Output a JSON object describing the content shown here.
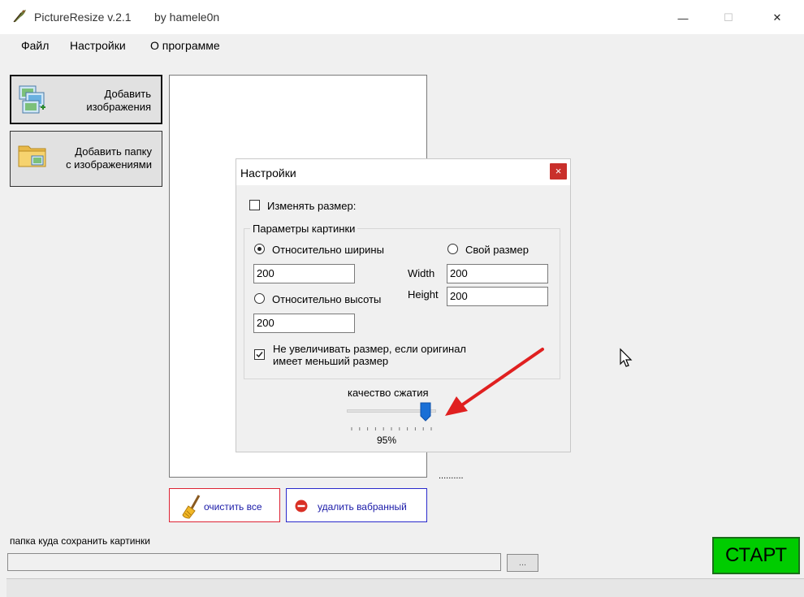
{
  "window": {
    "title": "PictureResize v.2.1",
    "author": "by hamele0n",
    "controls": {
      "minimize": "—",
      "maximize": "☐",
      "close": "✕"
    }
  },
  "menu": {
    "file": "Файл",
    "settings": "Настройки",
    "about": "О программе"
  },
  "buttons": {
    "add_images_line1": "Добавить",
    "add_images_line2": "изображения",
    "add_folder_line1": "Добавить папку",
    "add_folder_line2": "с изображениями",
    "clear_all": "очистить все",
    "delete_selected": "удалить вабранный",
    "browse": "...",
    "start": "СТАРТ"
  },
  "dots": {
    "row1": "..........",
    "row2": ".........."
  },
  "save_folder": {
    "label": "папка куда сохранить картинки",
    "value": ""
  },
  "settings_dialog": {
    "title": "Настройки",
    "close": "×",
    "resize_label": "Изменять размер:",
    "resize_checked": false,
    "params_group": "Параметры картинки",
    "relative_width_label": "Относительно ширины",
    "relative_width_selected": true,
    "custom_size_label": "Свой размер",
    "custom_size_selected": false,
    "width_value": "200",
    "custom_width_label": "Width",
    "custom_width_value": "200",
    "custom_height_label": "Height",
    "custom_height_value": "200",
    "relative_height_label": "Относительно высоты",
    "relative_height_selected": false,
    "height_value": "200",
    "no_enlarge_line1": "Не увеличивать размер, если оригинал",
    "no_enlarge_line2": "имеет меньший размер",
    "no_enlarge_checked": true,
    "quality_label": "качество сжатия",
    "quality_value": "95%",
    "quality_percent": 95
  },
  "colors": {
    "start_button": "#00cc00",
    "clear_border": "#dd2233",
    "delete_border": "#2a2acc",
    "annotation_arrow": "#e02020",
    "slider_thumb": "#1a6fd6"
  }
}
